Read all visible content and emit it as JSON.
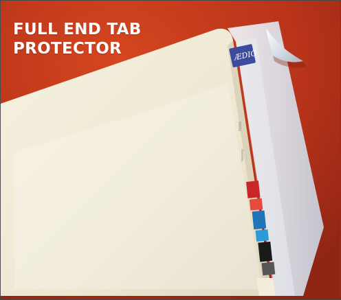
{
  "headline": {
    "line1": "FULL END TAB",
    "line2": "PROTECTOR"
  },
  "colors": {
    "background_red": "#c0391f",
    "background_red_dark": "#8f2514",
    "folder_cream": "#f1ebd8",
    "protector_sheet": "#e7ecf3",
    "label_blue": "#3c4c9c",
    "tab_red": "#c8262b",
    "tab_blue": "#1f74b8",
    "tab_black": "#1a1a1a"
  }
}
